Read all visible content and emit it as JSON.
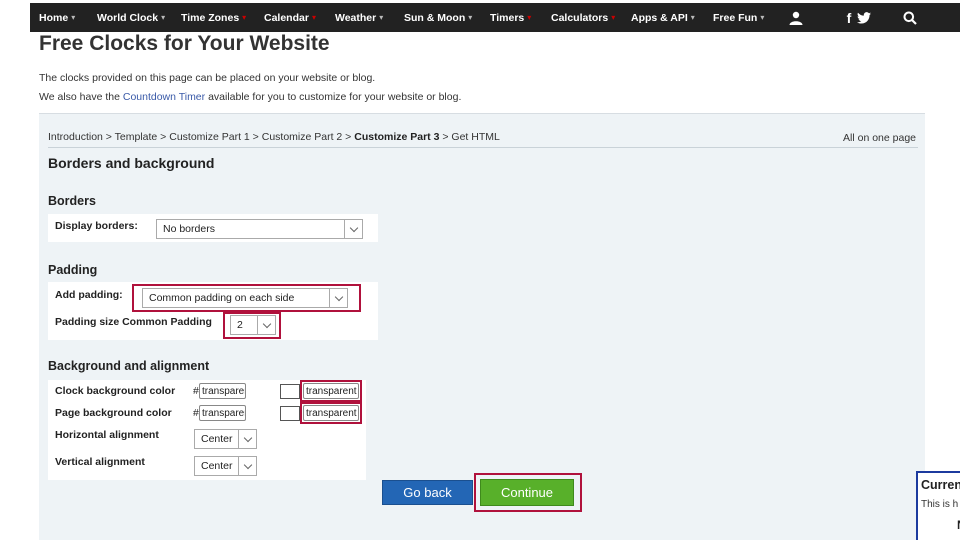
{
  "nav": {
    "items": [
      {
        "label": "Home",
        "caret": "▾"
      },
      {
        "label": "World Clock",
        "caret": "▾"
      },
      {
        "label": "Time Zones",
        "caret": "▾"
      },
      {
        "label": "Calendar",
        "caret": "▾"
      },
      {
        "label": "Weather",
        "caret": "▾"
      },
      {
        "label": "Sun & Moon",
        "caret": "▾"
      },
      {
        "label": "Timers",
        "caret": "▾"
      },
      {
        "label": "Calculators",
        "caret": "▾"
      },
      {
        "label": "Apps & API",
        "caret": "▾"
      },
      {
        "label": "Free Fun",
        "caret": "▾"
      }
    ],
    "facebook_glyph": "f"
  },
  "page": {
    "title": "Free Clocks for Your Website",
    "intro1": "The clocks provided on this page can be placed on your website or blog.",
    "intro2_before": "We also have the ",
    "intro2_link": "Countdown Timer",
    "intro2_after": " available for you to customize for your website or blog."
  },
  "breadcrumb": {
    "intro": "Introduction",
    "template": "Template",
    "part1": "Customize Part 1",
    "part2": "Customize Part 2",
    "part3": "Customize Part 3",
    "html": "Get HTML",
    "sep": " > ",
    "all_on_one": "All on one page"
  },
  "section": {
    "title": "Borders and background",
    "borders": {
      "heading": "Borders",
      "display_label": "Display borders:",
      "display_value": "No borders"
    },
    "padding": {
      "heading": "Padding",
      "add_label": "Add padding:",
      "add_value": "Common padding on each side",
      "size_label": "Padding size Common Padding",
      "size_value": "2"
    },
    "bg": {
      "heading": "Background and alignment",
      "clock_bg_label": "Clock background color",
      "page_bg_label": "Page background color",
      "hash": "#",
      "clock_hex_value": "transparent",
      "page_hex_value": "transparent",
      "clock_text_value": "transparent",
      "page_text_value": "transparent",
      "halign_label": "Horizontal alignment",
      "halign_value": "Center",
      "valign_label": "Vertical alignment",
      "valign_value": "Center"
    }
  },
  "buttons": {
    "back": "Go back",
    "continue": "Continue"
  },
  "side_panel": {
    "title": "Curren",
    "text": "This is h",
    "bold_letter": "N"
  },
  "colors": {
    "nav_bg": "#222222",
    "highlight": "#b0113c",
    "back_btn": "#2366b5",
    "continue_btn": "#58b02a",
    "link": "#3a5aa8"
  }
}
